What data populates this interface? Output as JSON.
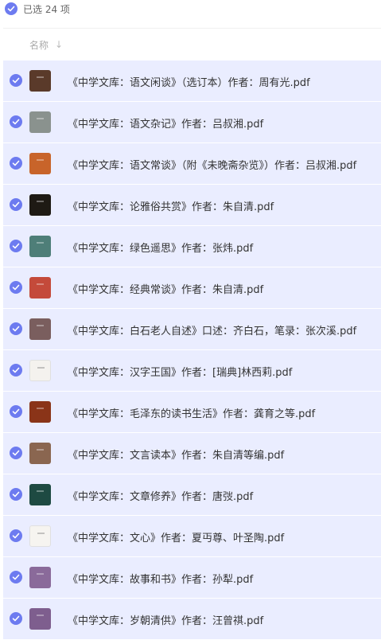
{
  "selection": {
    "text": "已选 24 项"
  },
  "column": {
    "name_label": "名称",
    "sort_icon": "arrow-down-icon"
  },
  "files": [
    {
      "name": "《中学文库：语文闲谈》（选订本）作者：周有光.pdf",
      "thumb_color": "#5a3a2a"
    },
    {
      "name": "《中学文库：语文杂记》作者：吕叔湘.pdf",
      "thumb_color": "#8a928e"
    },
    {
      "name": "《中学文库：语文常谈》（附《未晚斋杂览》）作者：吕叔湘.pdf",
      "thumb_color": "#c8642a"
    },
    {
      "name": "《中学文库：论雅俗共赏》作者：朱自清.pdf",
      "thumb_color": "#1e1a14"
    },
    {
      "name": "《中学文库：绿色遥思》作者：张炜.pdf",
      "thumb_color": "#4e7e78"
    },
    {
      "name": "《中学文库：经典常谈》作者：朱自清.pdf",
      "thumb_color": "#c44a3a"
    },
    {
      "name": "《中学文库：白石老人自述》口述：齐白石，笔录：张次溪.pdf",
      "thumb_color": "#7a5e5e"
    },
    {
      "name": "《中学文库：汉字王国》作者：[瑞典]林西莉.pdf",
      "thumb_color": "#f4f2ee",
      "light": true
    },
    {
      "name": "《中学文库：毛泽东的读书生活》作者：龚育之等.pdf",
      "thumb_color": "#8a3418"
    },
    {
      "name": "《中学文库：文言读本》作者：朱自清等编.pdf",
      "thumb_color": "#8a6650"
    },
    {
      "name": "《中学文库：文章修养》作者：唐弢.pdf",
      "thumb_color": "#1e4a42"
    },
    {
      "name": "《中学文库：文心》作者：夏丏尊、叶圣陶.pdf",
      "thumb_color": "#f6f4f0",
      "light": true
    },
    {
      "name": "《中学文库：故事和书》作者：孙犁.pdf",
      "thumb_color": "#8a6a9a"
    },
    {
      "name": "《中学文库：岁朝清供》作者：汪曾祺.pdf",
      "thumb_color": "#7e5e8e"
    }
  ]
}
